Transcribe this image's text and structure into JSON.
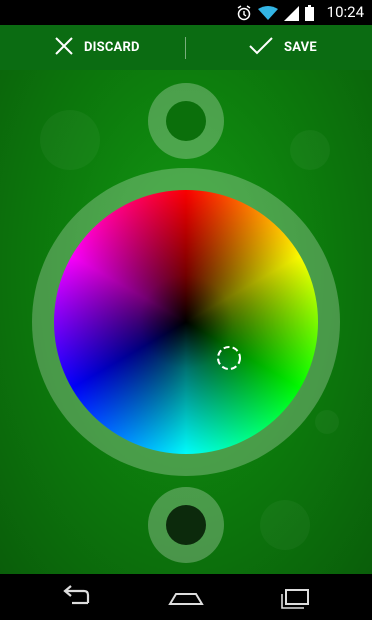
{
  "status_bar": {
    "time": "10:24",
    "icons": [
      "alarm-icon",
      "wifi-icon",
      "signal-icon",
      "battery-icon"
    ]
  },
  "action_bar": {
    "discard_label": "DISCARD",
    "save_label": "SAVE",
    "background": "#0b6c12"
  },
  "color_picker": {
    "selected_color_preview": "#0b6f0b",
    "original_color_preview": "#0c2a0c",
    "wheel": "hue-saturation-wheel"
  },
  "nav_bar": {
    "buttons": [
      "back-icon",
      "home-icon",
      "recent-apps-icon"
    ]
  }
}
